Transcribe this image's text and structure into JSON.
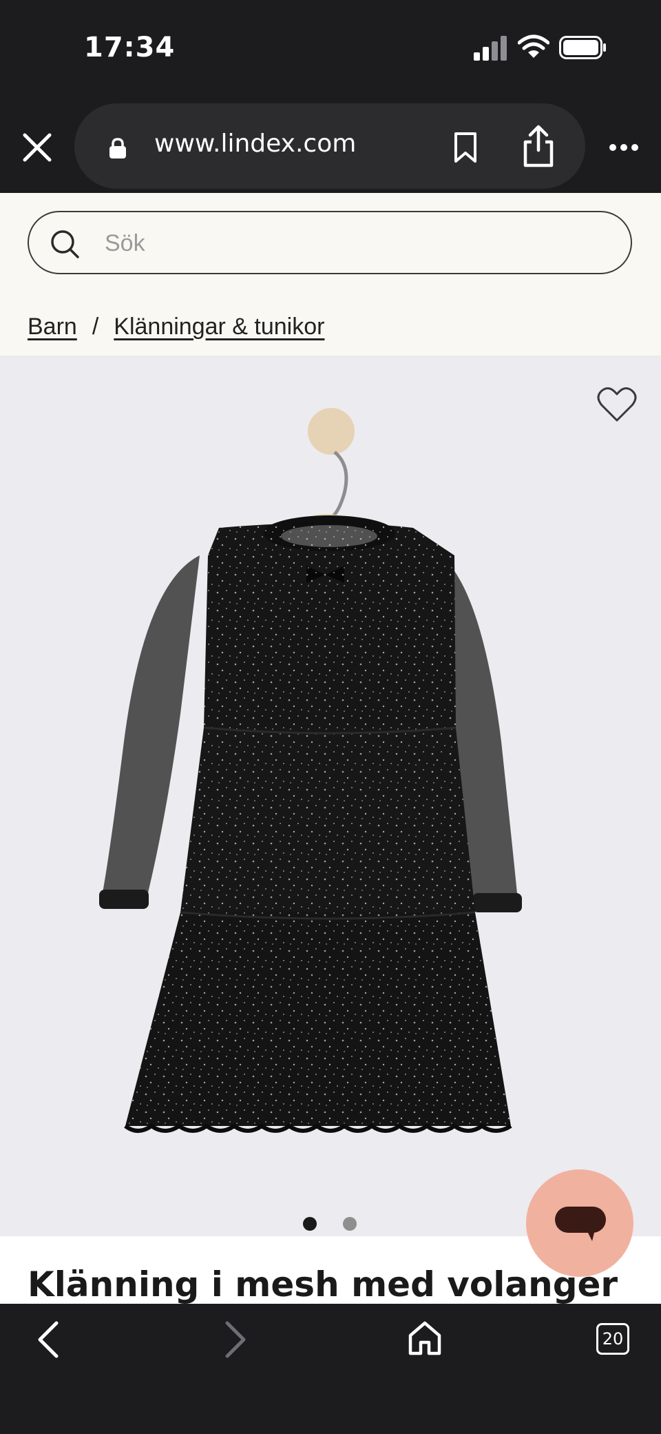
{
  "status_bar": {
    "time": "17:34"
  },
  "browser": {
    "url": "www.lindex.com",
    "tab_count": "20"
  },
  "search": {
    "placeholder": "Sök"
  },
  "breadcrumb": {
    "items": [
      "Barn",
      "Klänningar & tunikor"
    ],
    "separator": "/"
  },
  "product": {
    "title": "Klänning i mesh med volanger",
    "image_count": 2,
    "active_image": 1
  },
  "colors": {
    "chrome_bg": "#1c1c1e",
    "url_pill_bg": "#2c2c2e",
    "header_bg": "#faf8f3",
    "image_bg": "#ecebef",
    "chat_button": "#f1b19f",
    "dot_active": "#1a1a1a",
    "dot_inactive": "#8e8e8e"
  },
  "icons": [
    "signal-icon",
    "wifi-icon",
    "battery-icon",
    "close-icon",
    "lock-icon",
    "bookmark-icon",
    "share-icon",
    "more-icon",
    "search-icon",
    "heart-icon",
    "chat-icon",
    "back-icon",
    "forward-icon",
    "home-icon"
  ]
}
